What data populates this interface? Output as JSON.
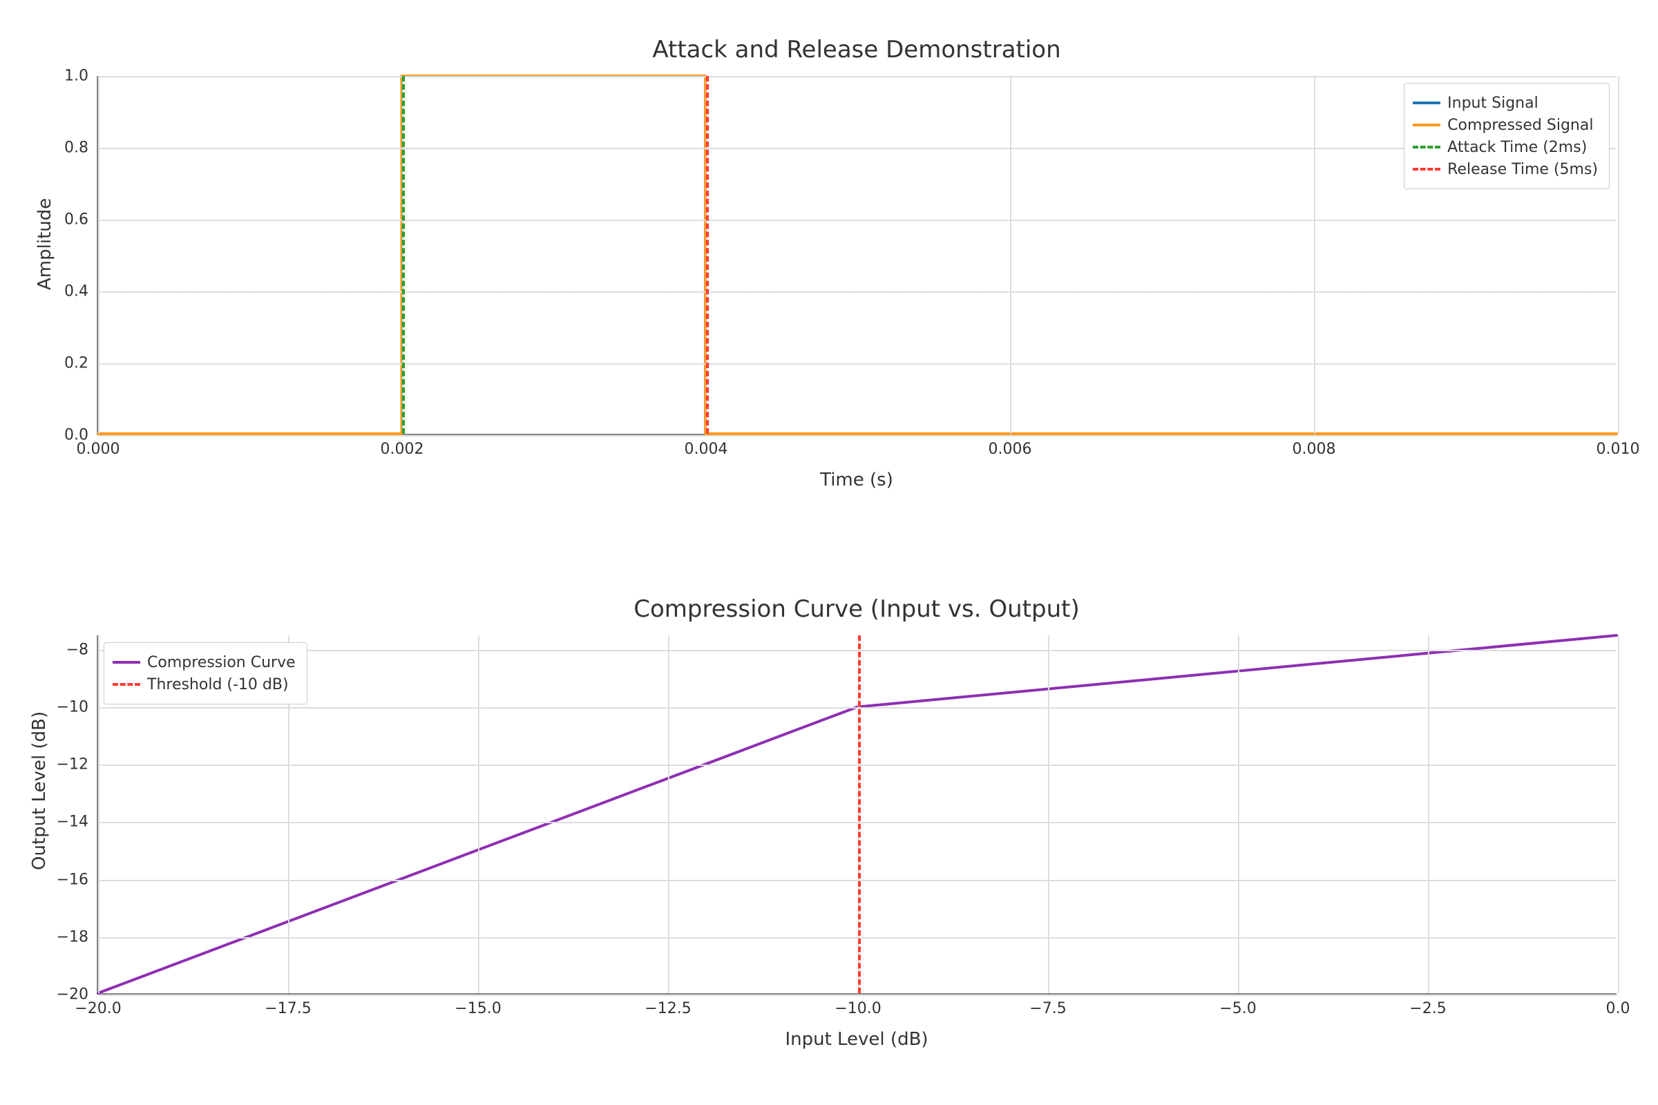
{
  "chart_data": [
    {
      "type": "line",
      "title": "Attack and Release Demonstration",
      "xlabel": "Time (s)",
      "ylabel": "Amplitude",
      "xlim": [
        0.0,
        0.01
      ],
      "ylim": [
        0.0,
        1.0
      ],
      "xticks": [
        0.0,
        0.002,
        0.004,
        0.006,
        0.008,
        0.01
      ],
      "yticks": [
        0.0,
        0.2,
        0.4,
        0.6,
        0.8,
        1.0
      ],
      "xtick_labels": [
        "0.000",
        "0.002",
        "0.004",
        "0.006",
        "0.008",
        "0.010"
      ],
      "ytick_labels": [
        "0.0",
        "0.2",
        "0.4",
        "0.6",
        "0.8",
        "1.0"
      ],
      "grid": true,
      "legend_position": "upper-right",
      "series": [
        {
          "name": "Input Signal",
          "color": "#1f77b4",
          "style": "solid",
          "x": [
            0.0,
            0.002,
            0.002,
            0.004,
            0.004,
            0.01
          ],
          "y": [
            0.0,
            0.0,
            1.0,
            1.0,
            0.0,
            0.0
          ]
        },
        {
          "name": "Compressed Signal",
          "color": "#ff9a1f",
          "style": "solid",
          "x": [
            0.0,
            0.002,
            0.002,
            0.004,
            0.004,
            0.01
          ],
          "y": [
            0.0,
            0.0,
            1.0,
            1.0,
            0.0,
            0.0
          ]
        }
      ],
      "vlines": [
        {
          "name": "Attack Time (2ms)",
          "x": 0.002,
          "color": "#2ca02c",
          "style": "dashed"
        },
        {
          "name": "Release Time (5ms)",
          "x": 0.004,
          "color": "#ff3b30",
          "style": "dashed"
        }
      ],
      "legend_entries": [
        "Input Signal",
        "Compressed Signal",
        "Attack Time (2ms)",
        "Release Time (5ms)"
      ]
    },
    {
      "type": "line",
      "title": "Compression Curve (Input vs. Output)",
      "xlabel": "Input Level (dB)",
      "ylabel": "Output Level (dB)",
      "xlim": [
        -20.0,
        0.0
      ],
      "ylim": [
        -20.0,
        -7.5
      ],
      "xticks": [
        -20.0,
        -17.5,
        -15.0,
        -12.5,
        -10.0,
        -7.5,
        -5.0,
        -2.5,
        0.0
      ],
      "yticks": [
        -20,
        -18,
        -16,
        -14,
        -12,
        -10,
        -8
      ],
      "xtick_labels": [
        "−20.0",
        "−17.5",
        "−15.0",
        "−12.5",
        "−10.0",
        "−7.5",
        "−5.0",
        "−2.5",
        "0.0"
      ],
      "ytick_labels": [
        "−20",
        "−18",
        "−16",
        "−14",
        "−12",
        "−10",
        "−8"
      ],
      "grid": true,
      "legend_position": "upper-left",
      "series": [
        {
          "name": "Compression Curve",
          "color": "#8e2fb3",
          "style": "solid",
          "x": [
            -20.0,
            -17.5,
            -15.0,
            -12.5,
            -10.0,
            -7.5,
            -5.0,
            -2.5,
            0.0
          ],
          "y": [
            -20.0,
            -17.5,
            -15.0,
            -12.5,
            -10.0,
            -9.375,
            -8.75,
            -8.125,
            -7.5
          ]
        }
      ],
      "vlines": [
        {
          "name": "Threshold (-10 dB)",
          "x": -10.0,
          "color": "#ff3b30",
          "style": "dashed"
        }
      ],
      "legend_entries": [
        "Compression Curve",
        "Threshold (-10 dB)"
      ]
    }
  ]
}
